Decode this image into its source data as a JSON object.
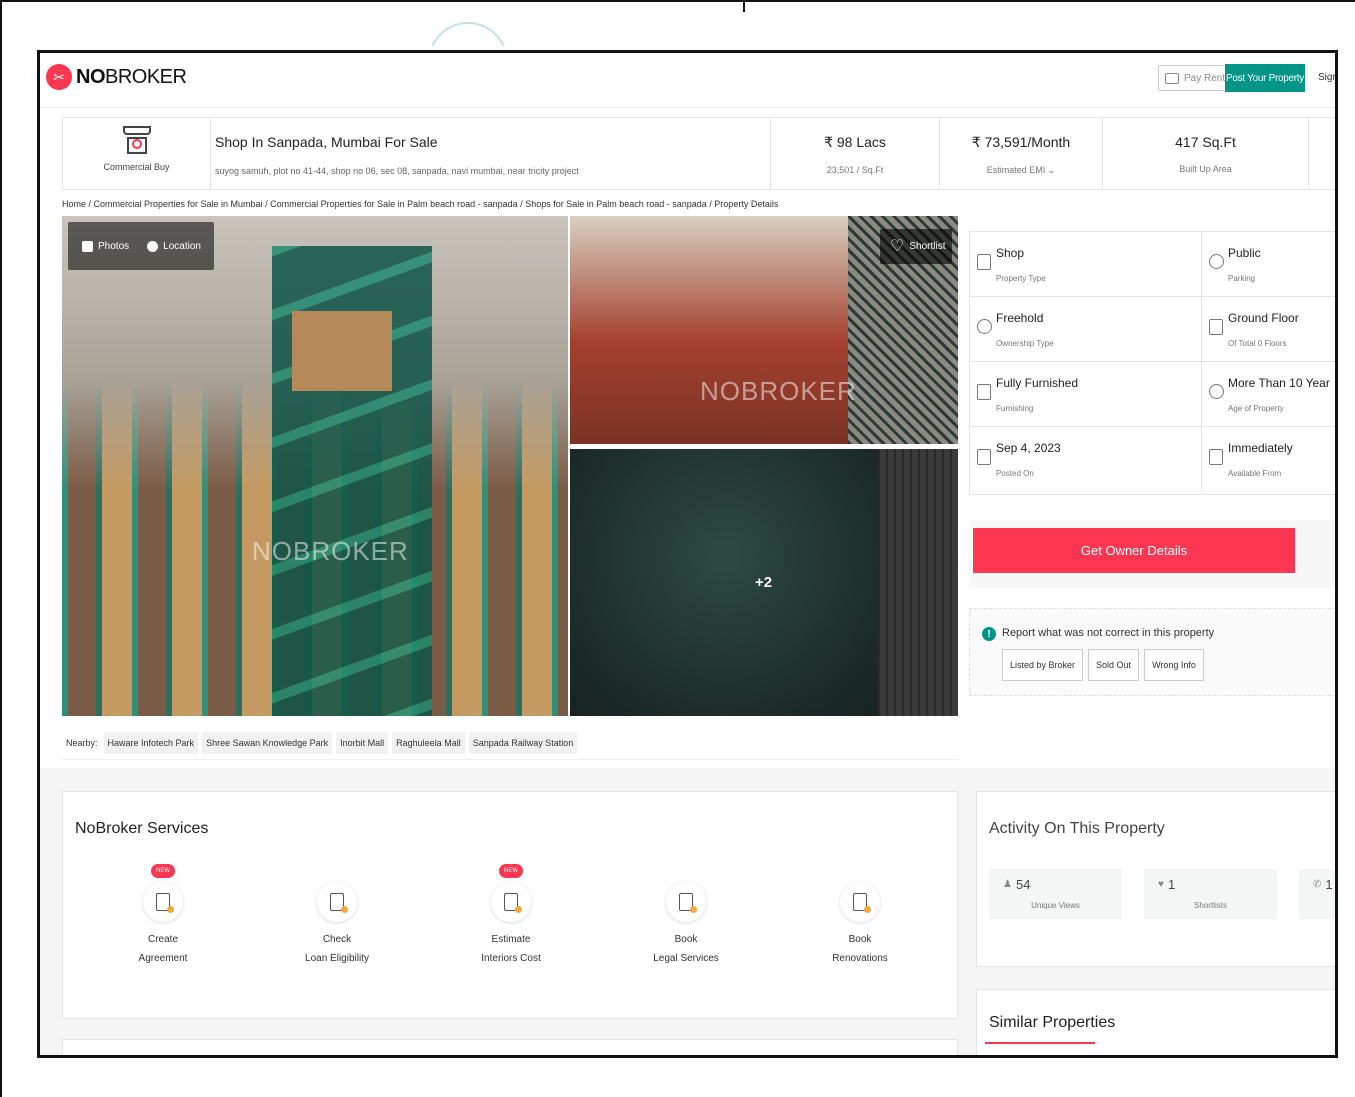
{
  "brand": {
    "logo_bold": "NO",
    "logo_rest": "BROKER"
  },
  "header": {
    "pay_rent": "Pay Rent",
    "post_property": "Post Your Property",
    "sign_in": "Sign"
  },
  "summary": {
    "type_label": "Commercial Buy",
    "title": "Shop In Sanpada, Mumbai For Sale",
    "address": "suyog samuh, plot no 41-44, shop no 06, sec 08, sanpada, navi mumbai, near tricity project",
    "price": "₹ 98 Lacs",
    "price_per_sqft": "23,501 / Sq.Ft",
    "emi": "₹ 73,591/Month",
    "emi_label": "Estimated EMI ⌄",
    "area": "417 Sq.Ft",
    "area_label": "Built Up Area"
  },
  "breadcrumb": "Home / Commercial Properties for Sale in Mumbai / Commercial Properties for Sale in Palm beach road - sanpada / Shops for Sale in Palm beach road - sanpada / Property Details",
  "gallery": {
    "photos_label": "Photos",
    "location_label": "Location",
    "shortlist_label": "Shortlist",
    "more_count": "+2",
    "watermark": "NOBROKER"
  },
  "nearby": {
    "label": "Nearby:",
    "places": [
      "Haware Infotech Park",
      "Shree Sawan Knowledge Park",
      "Inorbit Mall",
      "Raghuleela Mall",
      "Sanpada Railway Station"
    ]
  },
  "details": [
    {
      "value": "Shop",
      "label": "Property Type",
      "icon": "shop-icon"
    },
    {
      "value": "Public",
      "label": "Parking",
      "icon": "parking-icon"
    },
    {
      "value": "Freehold",
      "label": "Ownership Type",
      "icon": "owner-icon"
    },
    {
      "value": "Ground Floor",
      "label": "Of Total 0 Floors",
      "icon": "stairs-icon"
    },
    {
      "value": "Fully Furnished",
      "label": "Furnishing",
      "icon": "furnishing-icon"
    },
    {
      "value": "More Than 10 Year",
      "label": "Age of Property",
      "icon": "age-icon"
    },
    {
      "value": "Sep 4, 2023",
      "label": "Posted On",
      "icon": "flag-icon"
    },
    {
      "value": "Immediately",
      "label": "Available From",
      "icon": "calendar-icon"
    }
  ],
  "cta": {
    "label": "Get Owner Details"
  },
  "report": {
    "text": "Report what was not correct in this property",
    "options": [
      "Listed by Broker",
      "Sold Out",
      "Wrong Info"
    ]
  },
  "services": {
    "title": "NoBroker Services",
    "badge": "NEW",
    "items": [
      {
        "line1": "Create",
        "line2": "Agreement",
        "new": true,
        "icon": "agreement-icon"
      },
      {
        "line1": "Check",
        "line2": "Loan Eligibility",
        "new": false,
        "icon": "loan-icon"
      },
      {
        "line1": "Estimate",
        "line2": "Interiors Cost",
        "new": true,
        "icon": "interiors-icon"
      },
      {
        "line1": "Book",
        "line2": "Legal Services",
        "new": false,
        "icon": "legal-icon"
      },
      {
        "line1": "Book",
        "line2": "Renovations",
        "new": false,
        "icon": "renovation-icon"
      }
    ]
  },
  "activity": {
    "title": "Activity On This Property",
    "stats": [
      {
        "value": "54",
        "label": "Unique Views",
        "icon": "person-icon"
      },
      {
        "value": "1",
        "label": "Shortlists",
        "icon": "heart-icon"
      },
      {
        "value": "1",
        "label": "",
        "icon": "phone-icon"
      }
    ]
  },
  "similar": {
    "title": "Similar Properties"
  },
  "colors": {
    "accent": "#fd3752",
    "teal": "#009587"
  }
}
